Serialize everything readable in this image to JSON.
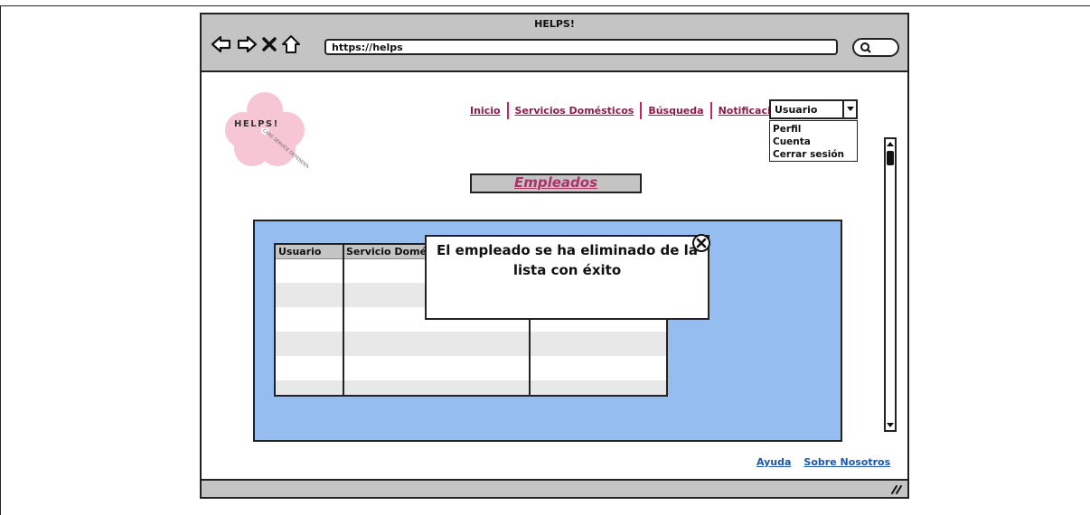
{
  "window": {
    "title": "HELPS!"
  },
  "address_bar": {
    "url": "https://helps"
  },
  "logo": {
    "text": "HELPS!",
    "tagline": "CARE SERVICE DEPENDENCE"
  },
  "nav": {
    "items": [
      {
        "label": "Inicio"
      },
      {
        "label": "Servicios Domésticos"
      },
      {
        "label": "Búsqueda"
      },
      {
        "label": "Notificaciones"
      }
    ]
  },
  "user_menu": {
    "selected": "Usuario",
    "options": [
      "Perfil",
      "Cuenta",
      "Cerrar sesión"
    ]
  },
  "page": {
    "title": "Empleados"
  },
  "table": {
    "columns": [
      "Usuario",
      "Servicio Domésti"
    ]
  },
  "modal": {
    "line1": "El empleado se ha eliminado de la",
    "line2": "lista con éxito"
  },
  "footer": {
    "links": [
      "Ayuda",
      "Sobre Nosotros"
    ]
  },
  "colors": {
    "chrome": "#c4c4c4",
    "panel": "#96bdef",
    "nav_link": "#8b1c4a",
    "title_text": "#b0306a",
    "footer_link": "#1b57a8",
    "logo_pink": "#f7c6d4"
  }
}
